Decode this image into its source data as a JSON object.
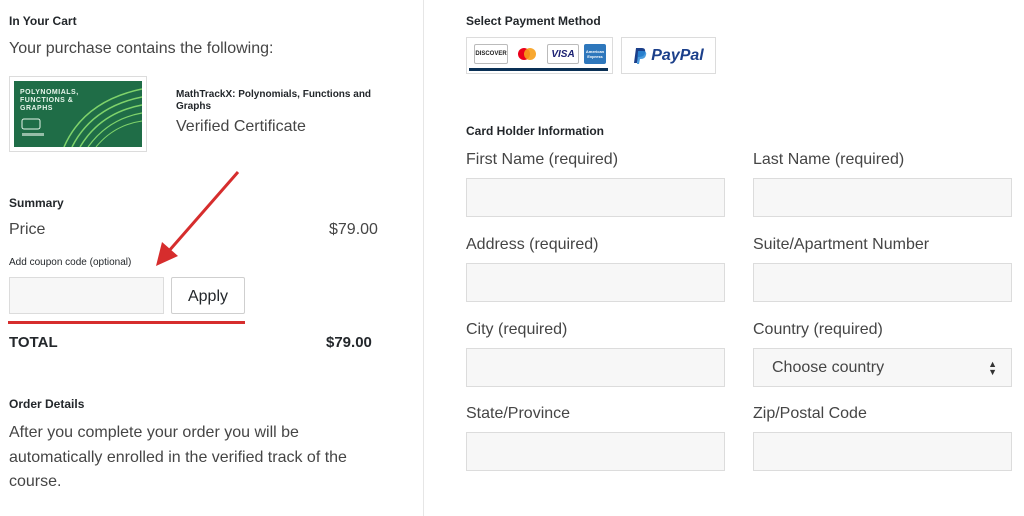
{
  "cart": {
    "heading": "In Your Cart",
    "intro": "Your purchase contains the following:",
    "item": {
      "thumbnail_text": "POLYNOMIALS, FUNCTIONS & GRAPHS",
      "title": "MathTrackX: Polynomials, Functions and Graphs",
      "type": "Verified Certificate"
    }
  },
  "summary": {
    "heading": "Summary",
    "price_label": "Price",
    "price_value": "$79.00",
    "coupon_label": "Add coupon code (optional)",
    "coupon_value": "",
    "apply_label": "Apply",
    "total_label": "TOTAL",
    "total_value": "$79.00"
  },
  "order_details": {
    "heading": "Order Details",
    "text": "After you complete your order you will be automatically enrolled in the verified track of the course."
  },
  "payment": {
    "heading": "Select Payment Method",
    "cards": [
      "DISCOVER",
      "Mastercard",
      "VISA",
      "American Express"
    ],
    "paypal_label": "PayPal"
  },
  "card_holder": {
    "heading": "Card Holder Information",
    "first_name_label": "First Name (required)",
    "last_name_label": "Last Name (required)",
    "address_label": "Address (required)",
    "suite_label": "Suite/Apartment Number",
    "city_label": "City (required)",
    "country_label": "Country (required)",
    "country_selected": "Choose country",
    "state_label": "State/Province",
    "zip_label": "Zip/Postal Code"
  },
  "colors": {
    "annotation_red": "#d62d2d",
    "card_underline": "#0a3055",
    "thumbnail_green": "#1f6d47"
  }
}
